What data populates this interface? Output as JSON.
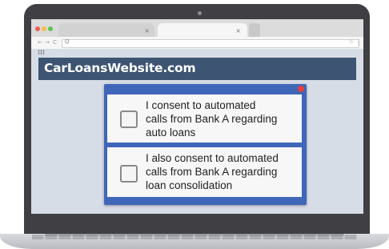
{
  "browser": {
    "tab_close_glyph": "×",
    "nav": {
      "back": "←",
      "forward": "→",
      "reload": "C"
    },
    "url": {
      "search_glyph": "Q",
      "star_glyph": "☆",
      "menu_glyph": "⋮"
    }
  },
  "site": {
    "title": "CarLoansWebsite.com"
  },
  "dialog": {
    "options": [
      {
        "lines": [
          "I consent to automated",
          "calls from Bank A regarding",
          "auto loans"
        ],
        "checked": false
      },
      {
        "lines": [
          "I also consent to automated",
          "calls from Bank A regarding",
          "loan consolidation"
        ],
        "checked": false
      }
    ]
  },
  "colors": {
    "header": "#3d5573",
    "dialog_border": "#3f66b8",
    "close_dot": "#e5403a",
    "screen_bg": "#d7dde6"
  }
}
